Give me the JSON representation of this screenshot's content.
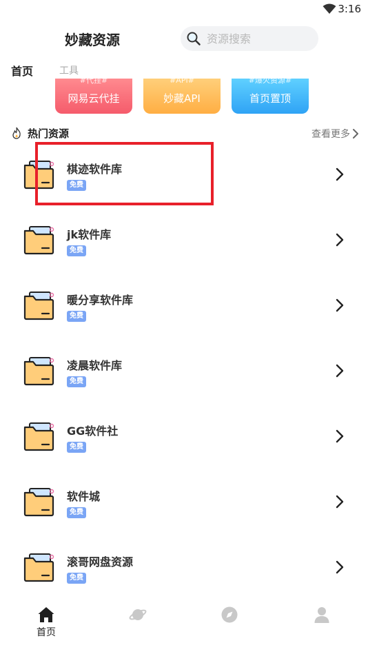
{
  "status_bar": {
    "time": "3:16",
    "wifi_icon": "wifi-icon"
  },
  "header": {
    "title": "妙藏资源"
  },
  "search": {
    "placeholder": "资源搜索",
    "icon": "search-icon"
  },
  "tabs": [
    {
      "label": "首页",
      "active": true
    },
    {
      "label": "工具",
      "active": false
    }
  ],
  "banners": [
    {
      "tag": "#代挂#",
      "label": "网易云代挂",
      "color": "#f55b6b"
    },
    {
      "tag": "#API#",
      "label": "妙藏API",
      "color": "#ffae43"
    },
    {
      "tag": "#爆火资源#",
      "label": "首页置顶",
      "color": "#2fa3f5"
    }
  ],
  "section": {
    "title": "热门资源",
    "see_more": "查看更多",
    "icon": "fire-icon"
  },
  "resources": [
    {
      "name": "棋迹软件库",
      "badge": "免费"
    },
    {
      "name": "jk软件库",
      "badge": "免费"
    },
    {
      "name": "暖分享软件库",
      "badge": "免费"
    },
    {
      "name": "凌晨软件库",
      "badge": "免费"
    },
    {
      "name": "GG软件社",
      "badge": "免费"
    },
    {
      "name": "软件城",
      "badge": "免费"
    },
    {
      "name": "滚哥网盘资源",
      "badge": "免费"
    }
  ],
  "bottom_nav": [
    {
      "label": "首页",
      "icon": "home-icon",
      "active": true
    },
    {
      "label": "",
      "icon": "planet-icon",
      "active": false
    },
    {
      "label": "",
      "icon": "compass-icon",
      "active": false
    },
    {
      "label": "",
      "icon": "user-icon",
      "active": false
    }
  ],
  "colors": {
    "accent": "#7aa5f5",
    "highlight": "#e8202a",
    "text": "#222222"
  }
}
